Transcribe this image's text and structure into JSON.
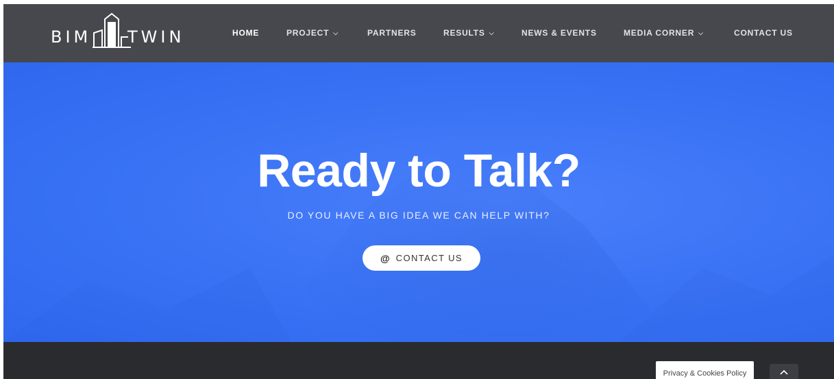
{
  "header": {
    "logo": {
      "left_text": "BIM",
      "right_text": "TWIN"
    },
    "nav": [
      {
        "label": "HOME",
        "dropdown": false,
        "active": true
      },
      {
        "label": "PROJECT",
        "dropdown": true,
        "active": false
      },
      {
        "label": "PARTNERS",
        "dropdown": false,
        "active": false
      },
      {
        "label": "RESULTS",
        "dropdown": true,
        "active": false
      },
      {
        "label": "NEWS & EVENTS",
        "dropdown": false,
        "active": false
      },
      {
        "label": "MEDIA CORNER",
        "dropdown": true,
        "active": false
      },
      {
        "label": "CONTACT US",
        "dropdown": false,
        "active": false
      }
    ]
  },
  "hero": {
    "title": "Ready to Talk?",
    "subtitle": "DO YOU HAVE A BIG IDEA WE CAN HELP WITH?",
    "cta": {
      "icon": "@",
      "label": "CONTACT US"
    }
  },
  "footer": {
    "privacy_label": "Privacy & Cookies Policy",
    "to_top_icon": "chevron-up-icon"
  },
  "colors": {
    "header_bg": "#47484d",
    "hero_bg": "#3b74f5",
    "footer_bg": "#2a2b2f"
  }
}
